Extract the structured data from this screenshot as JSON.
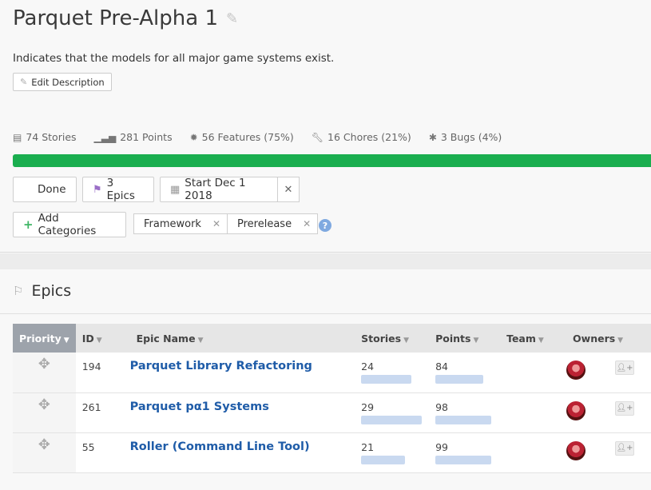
{
  "milestone": {
    "title": "Parquet Pre-Alpha 1",
    "description": "Indicates that the models for all major game systems exist.",
    "edit_description_label": "Edit Description"
  },
  "stats": {
    "stories": "74 Stories",
    "points": "281 Points",
    "features": "56 Features (75%)",
    "chores": "16 Chores (21%)",
    "bugs": "3 Bugs (4%)"
  },
  "progress": {
    "done_fraction": 1.0,
    "color": "#1aae4f"
  },
  "actions": {
    "done_label": "Done",
    "epics_label": "3 Epics",
    "start_label": "Start Dec 1 2018",
    "add_categories_label": "Add Categories"
  },
  "categories": [
    {
      "label": "Framework"
    },
    {
      "label": "Prerelease"
    }
  ],
  "epics_section": {
    "title": "Epics",
    "columns": {
      "priority": "Priority",
      "id": "ID",
      "name": "Epic Name",
      "stories": "Stories",
      "points": "Points",
      "team": "Team",
      "owners": "Owners"
    },
    "rows": [
      {
        "id": "194",
        "name": "Parquet Library Refactoring",
        "stories": "24",
        "points": "84"
      },
      {
        "id": "261",
        "name": "Parquet pα1 Systems",
        "stories": "29",
        "points": "98"
      },
      {
        "id": "55",
        "name": "Roller (Command Line Tool)",
        "stories": "21",
        "points": "99"
      }
    ]
  },
  "icons": {
    "edit": "pencil-icon",
    "stories": "list-icon",
    "points": "bars-icon",
    "features": "star-icon",
    "chores": "wrench-icon",
    "bugs": "bug-icon",
    "epics": "flag-icon",
    "calendar": "calendar-icon",
    "drag": "move-icon",
    "add_owner": "add-user-icon"
  },
  "colors": {
    "accent_link": "#1f5ca8",
    "progress": "#1aae4f",
    "epic_flag": "#9b6fc7",
    "help": "#7fa9e0"
  }
}
